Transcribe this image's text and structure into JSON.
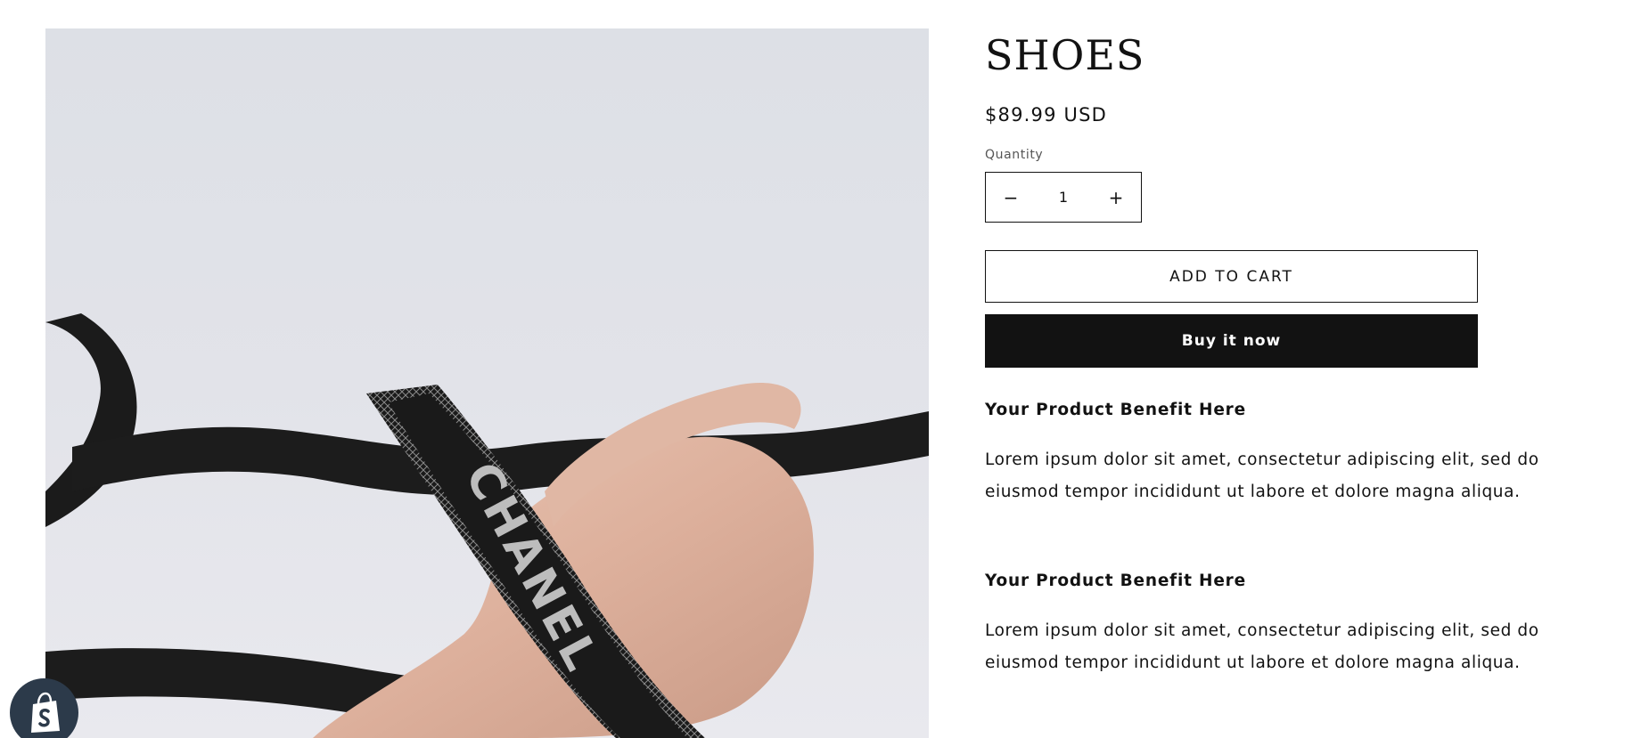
{
  "product": {
    "title": "SHOES",
    "price": "$89.99 USD",
    "image_alt": "shoes"
  },
  "quantity": {
    "label": "Quantity",
    "value": "1",
    "decrease_symbol": "−",
    "increase_symbol": "+"
  },
  "actions": {
    "add_to_cart": "ADD TO CART",
    "buy_now": "Buy it now"
  },
  "benefits": [
    {
      "title": "Your Product Benefit Here",
      "text": "Lorem ipsum dolor sit amet, consectetur adipiscing elit, sed do eiusmod tempor incididunt ut labore et dolore magna aliqua."
    },
    {
      "title": "Your Product Benefit Here",
      "text": "Lorem ipsum dolor sit amet, consectetur adipiscing elit, sed do eiusmod tempor incididunt ut labore et dolore magna aliqua."
    }
  ],
  "image_text": "CHANEL",
  "icons": {
    "shop_badge": "shopify-bag-icon"
  },
  "colors": {
    "text": "#121212",
    "buy_now_bg": "#121212",
    "badge_bg": "#2c3a4a"
  }
}
